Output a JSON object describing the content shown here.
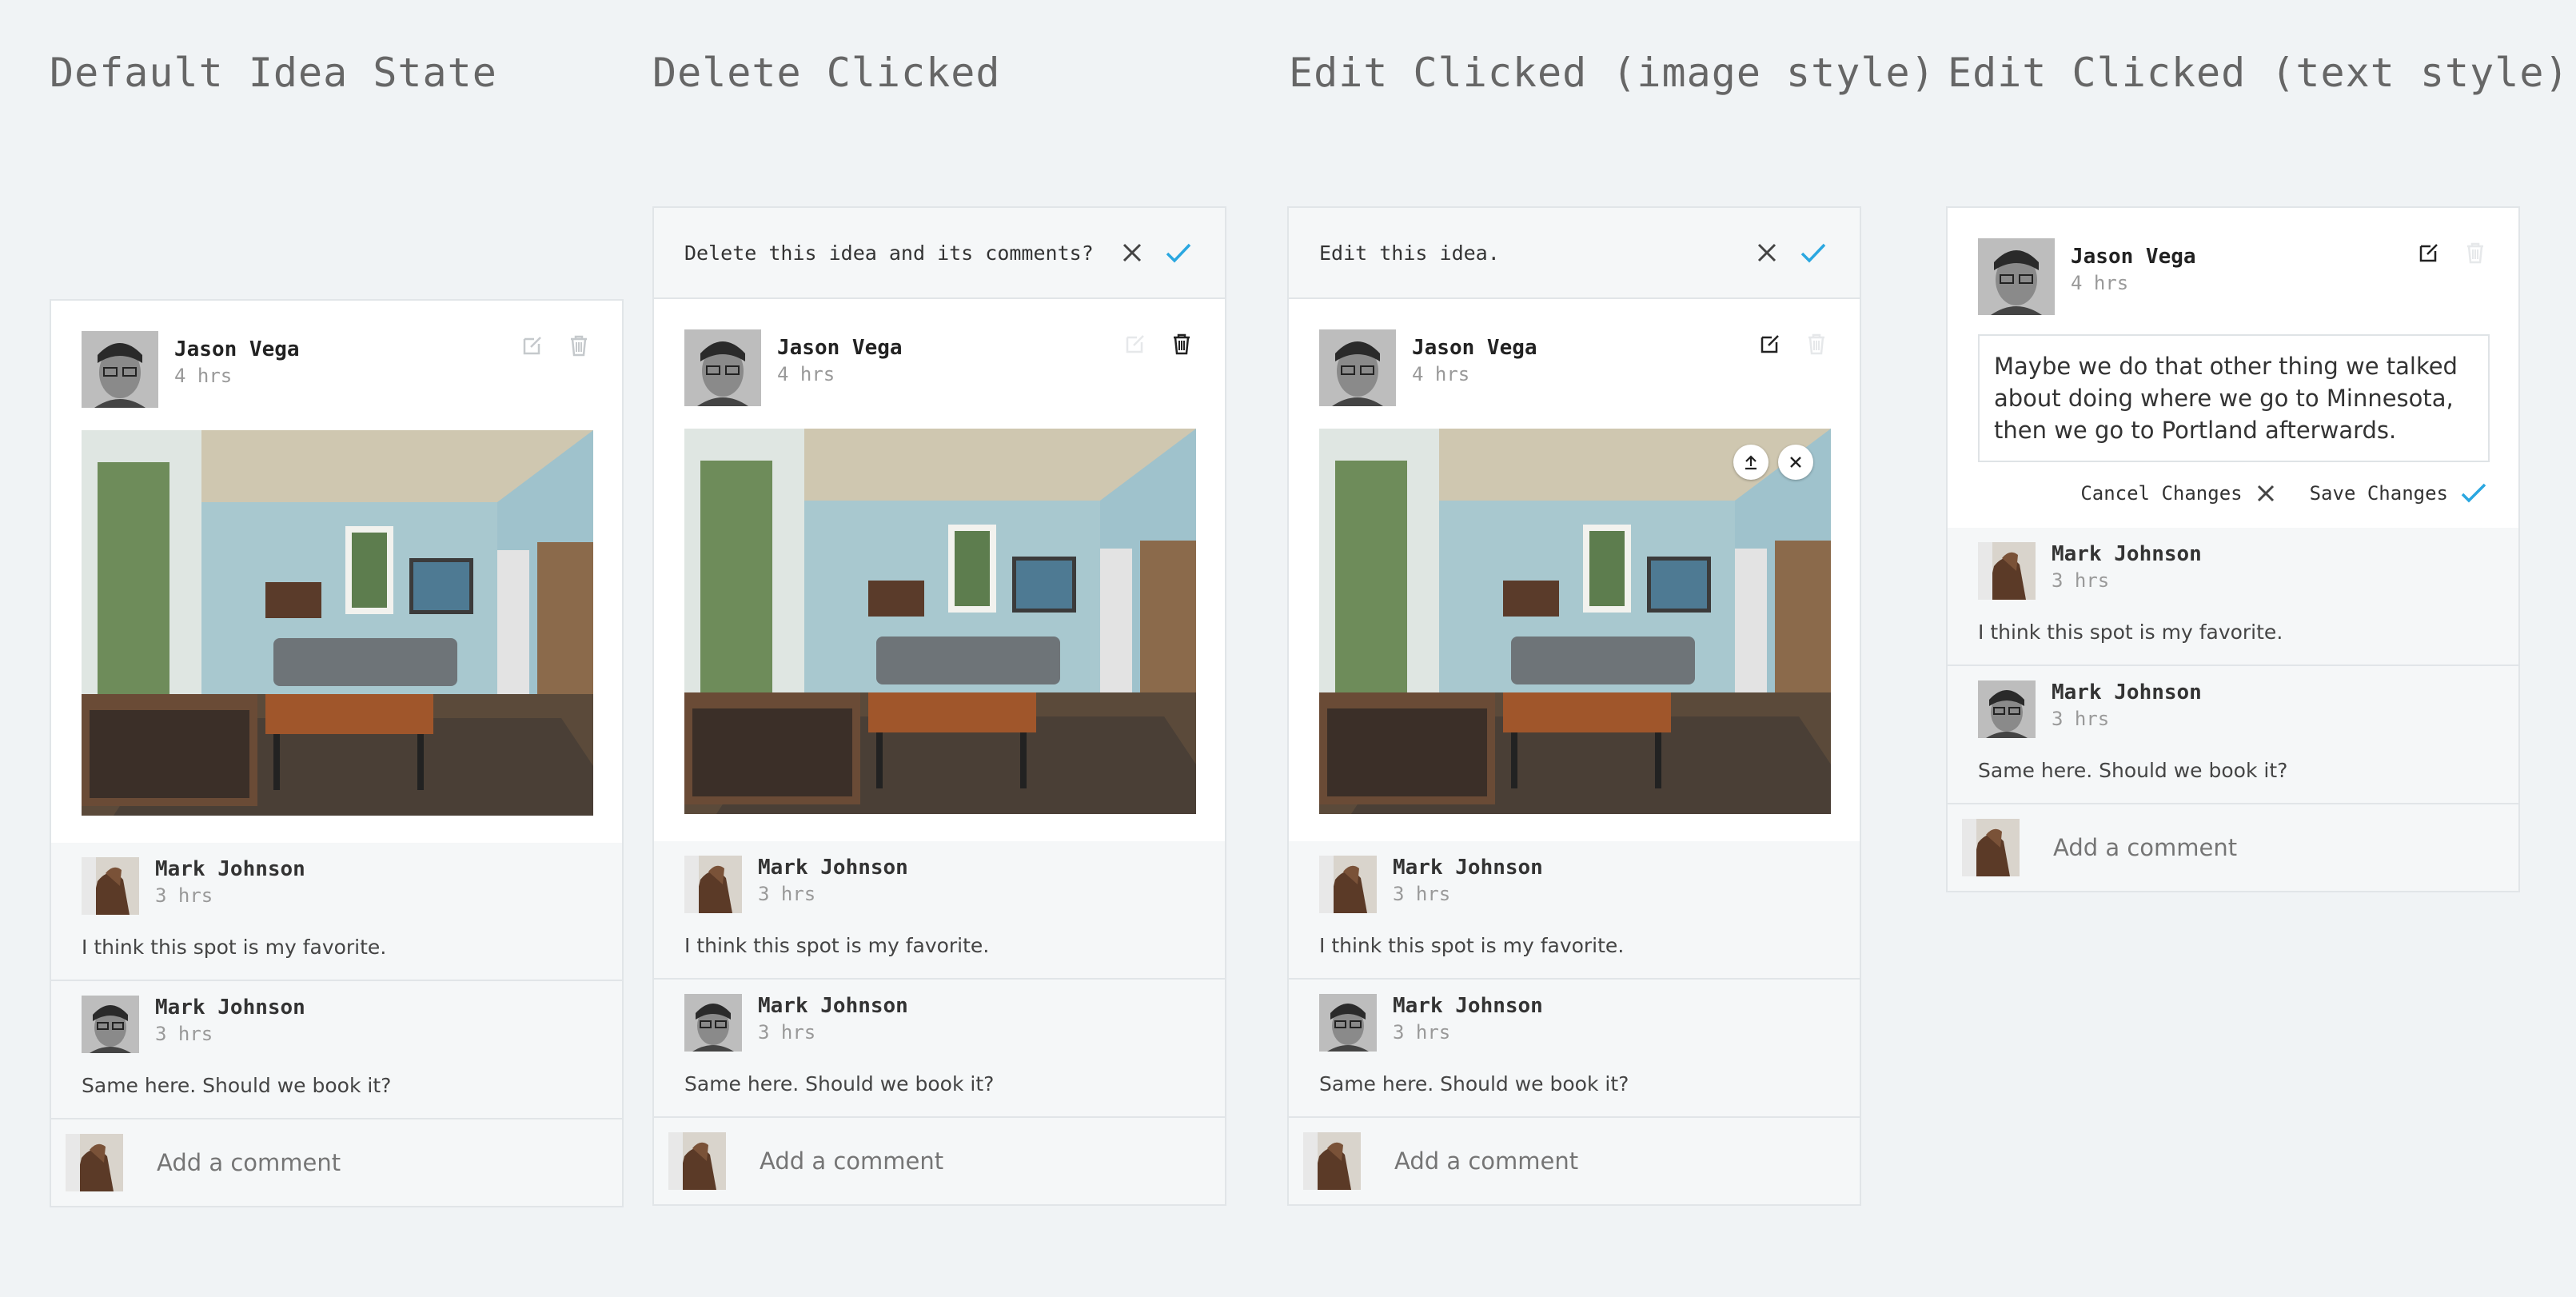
{
  "columns": [
    {
      "title": "Default Idea State"
    },
    {
      "title": "Delete Clicked"
    },
    {
      "title": "Edit Clicked (image style)"
    },
    {
      "title": "Edit Clicked (text style)"
    }
  ],
  "confirm": {
    "delete_text": "Delete this idea and its comments?",
    "edit_text": "Edit this idea."
  },
  "idea": {
    "author": "Jason Vega",
    "time": "4 hrs",
    "edit_text": "Maybe we do that other thing we talked about doing where we go to Minnesota, then we go to Portland afterwards.",
    "cancel_label": "Cancel Changes",
    "save_label": "Save Changes"
  },
  "comments": [
    {
      "author": "Mark Johnson",
      "time": "3 hrs",
      "text": "I think this spot is my favorite."
    },
    {
      "author": "Mark Johnson",
      "time": "3 hrs",
      "text": "Same here. Should we book it?"
    }
  ],
  "add_comment": {
    "placeholder": "Add a comment"
  },
  "colors": {
    "accent": "#2aa7e0",
    "muted_icon": "#c5c9cc",
    "dark_icon": "#333333"
  },
  "icons": [
    "edit-icon",
    "trash-icon",
    "close-icon",
    "check-icon",
    "upload-icon"
  ]
}
